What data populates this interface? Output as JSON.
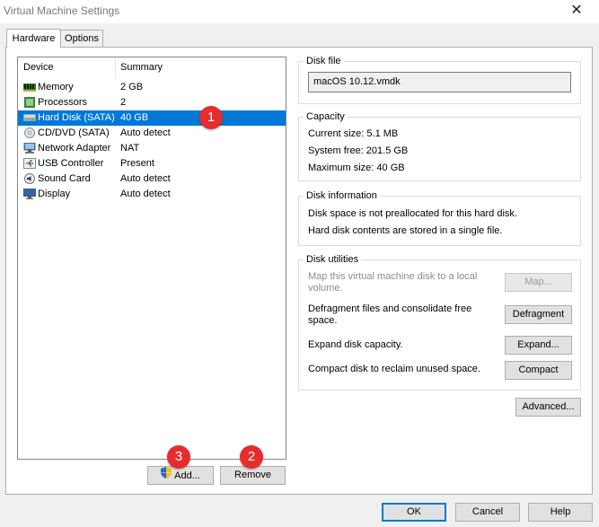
{
  "window": {
    "title": "Virtual Machine Settings",
    "close_glyph": "✕"
  },
  "tabs": [
    {
      "label": "Hardware",
      "active": true
    },
    {
      "label": "Options",
      "active": false
    }
  ],
  "device_list": {
    "headers": {
      "device": "Device",
      "summary": "Summary"
    },
    "rows": [
      {
        "device": "Memory",
        "summary": "2 GB",
        "icon": "memory-icon"
      },
      {
        "device": "Processors",
        "summary": "2",
        "icon": "processor-icon"
      },
      {
        "device": "Hard Disk (SATA)",
        "summary": "40 GB",
        "icon": "hard-disk-icon",
        "selected": true
      },
      {
        "device": "CD/DVD (SATA)",
        "summary": "Auto detect",
        "icon": "cd-dvd-icon"
      },
      {
        "device": "Network Adapter",
        "summary": "NAT",
        "icon": "network-adapter-icon"
      },
      {
        "device": "USB Controller",
        "summary": "Present",
        "icon": "usb-icon"
      },
      {
        "device": "Sound Card",
        "summary": "Auto detect",
        "icon": "sound-card-icon"
      },
      {
        "device": "Display",
        "summary": "Auto detect",
        "icon": "display-icon"
      }
    ],
    "add_label": "Add...",
    "remove_label": "Remove"
  },
  "disk_file": {
    "legend": "Disk file",
    "value": "macOS 10.12.vmdk"
  },
  "capacity": {
    "legend": "Capacity",
    "current": "Current size: 5.1 MB",
    "system_free": "System free: 201.5 GB",
    "maximum": "Maximum size: 40 GB"
  },
  "disk_info": {
    "legend": "Disk information",
    "line1": "Disk space is not preallocated for this hard disk.",
    "line2": "Hard disk contents are stored in a single file."
  },
  "disk_utilities": {
    "legend": "Disk utilities",
    "map_text": "Map this virtual machine disk to a local volume.",
    "map_label": "Map...",
    "defrag_text": "Defragment files and consolidate free space.",
    "defrag_label": "Defragment",
    "expand_text": "Expand disk capacity.",
    "expand_label": "Expand...",
    "compact_text": "Compact disk to reclaim unused space.",
    "compact_label": "Compact"
  },
  "advanced_label": "Advanced...",
  "footer": {
    "ok_label": "OK",
    "cancel_label": "Cancel",
    "help_label": "Help"
  },
  "annotations": {
    "badge1": "1",
    "badge2": "2",
    "badge3": "3"
  },
  "colors": {
    "selection": "#0078d7",
    "badge": "#e52d2d"
  }
}
